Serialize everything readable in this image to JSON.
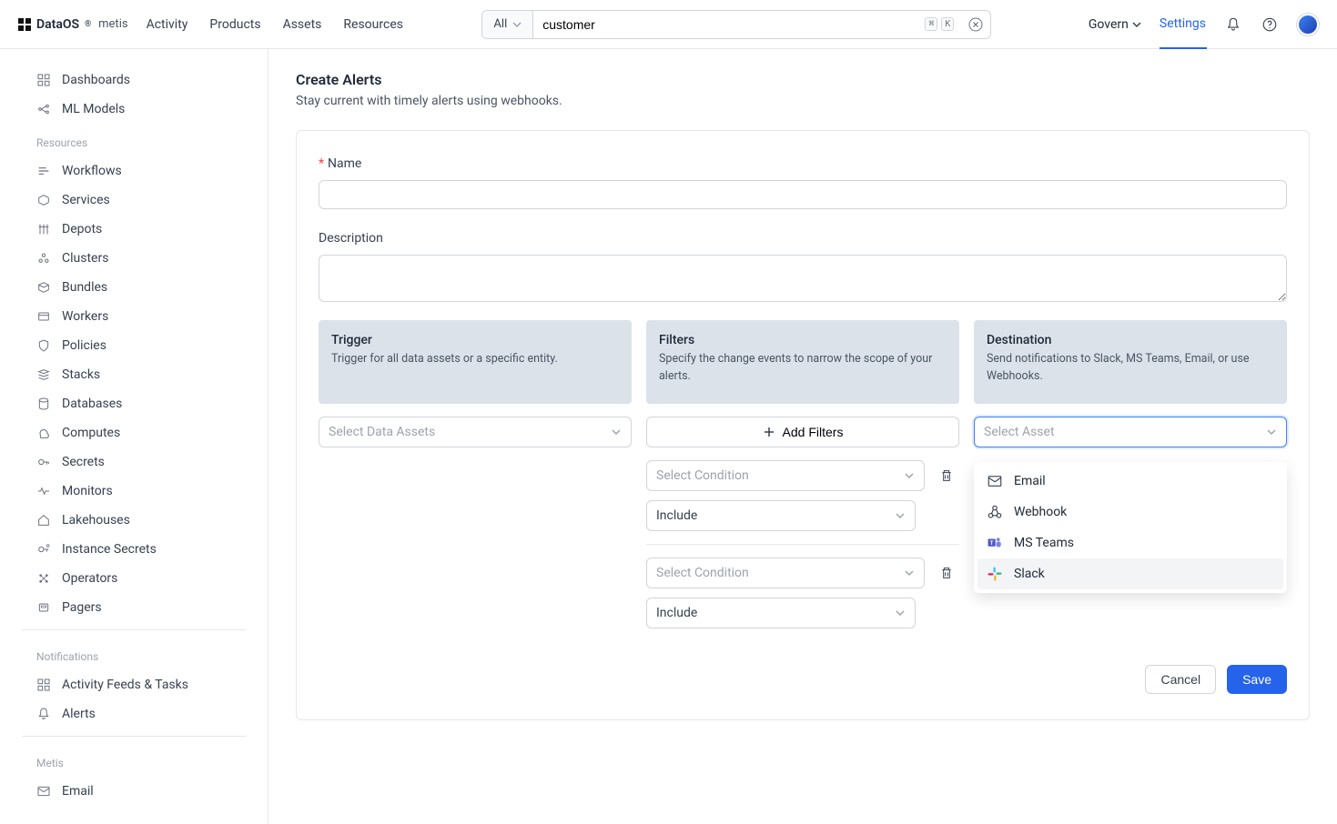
{
  "header": {
    "logo_brand": "DataOS",
    "logo_reg": "®",
    "logo_app": "metis",
    "nav": [
      "Activity",
      "Products",
      "Assets",
      "Resources"
    ],
    "search_scope": "All",
    "search_value": "customer",
    "kbd1": "⌘",
    "kbd2": "K",
    "govern": "Govern",
    "settings": "Settings"
  },
  "sidebar": {
    "top_items": [
      {
        "label": "Dashboards",
        "icon": "dashboards"
      },
      {
        "label": "ML Models",
        "icon": "ml"
      }
    ],
    "resources_heading": "Resources",
    "resources": [
      {
        "label": "Workflows",
        "icon": "workflows"
      },
      {
        "label": "Services",
        "icon": "services"
      },
      {
        "label": "Depots",
        "icon": "depots"
      },
      {
        "label": "Clusters",
        "icon": "clusters"
      },
      {
        "label": "Bundles",
        "icon": "bundles"
      },
      {
        "label": "Workers",
        "icon": "workers"
      },
      {
        "label": "Policies",
        "icon": "policies"
      },
      {
        "label": "Stacks",
        "icon": "stacks"
      },
      {
        "label": "Databases",
        "icon": "databases"
      },
      {
        "label": "Computes",
        "icon": "computes"
      },
      {
        "label": "Secrets",
        "icon": "secrets"
      },
      {
        "label": "Monitors",
        "icon": "monitors"
      },
      {
        "label": "Lakehouses",
        "icon": "lakehouses"
      },
      {
        "label": "Instance Secrets",
        "icon": "instance-secrets"
      },
      {
        "label": "Operators",
        "icon": "operators"
      },
      {
        "label": "Pagers",
        "icon": "pagers"
      }
    ],
    "notifications_heading": "Notifications",
    "notifications": [
      {
        "label": "Activity Feeds & Tasks",
        "icon": "activity-feeds"
      },
      {
        "label": "Alerts",
        "icon": "alerts"
      }
    ],
    "metis_heading": "Metis",
    "metis": [
      {
        "label": "Email",
        "icon": "email"
      }
    ]
  },
  "main": {
    "title": "Create Alerts",
    "subtitle": "Stay current with timely alerts using webhooks.",
    "name_label": "Name",
    "description_label": "Description",
    "columns": {
      "trigger": {
        "title": "Trigger",
        "desc": "Trigger for all data assets or a specific entity.",
        "placeholder": "Select Data Assets"
      },
      "filters": {
        "title": "Filters",
        "desc": "Specify the change events to narrow the scope of your alerts.",
        "add_label": "Add Filters",
        "condition_placeholder": "Select Condition",
        "include_label": "Include"
      },
      "destination": {
        "title": "Destination",
        "desc": "Send notifications to Slack, MS Teams, Email, or use Webhooks.",
        "placeholder": "Select Asset",
        "options": [
          {
            "label": "Email",
            "icon": "email"
          },
          {
            "label": "Webhook",
            "icon": "webhook"
          },
          {
            "label": "MS Teams",
            "icon": "msteams"
          },
          {
            "label": "Slack",
            "icon": "slack"
          }
        ]
      }
    },
    "cancel": "Cancel",
    "save": "Save"
  }
}
